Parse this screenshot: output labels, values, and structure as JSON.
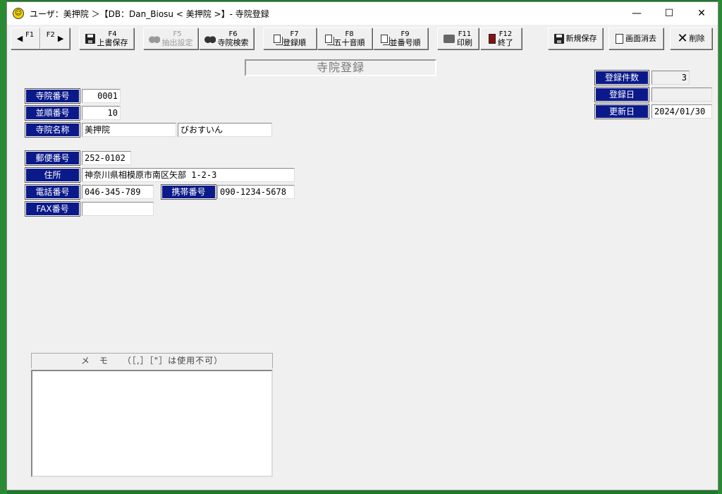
{
  "window": {
    "title": "ユーザ：美押院 ＞【DB：Dan_Biosu < 美押院 >】- 寺院登録"
  },
  "toolbar": {
    "prev_label": "F1",
    "next_label": "F2",
    "f4_key": "F4",
    "f4_label": "上書保存",
    "f5_key": "F5",
    "f5_label": "抽出設定",
    "f6_key": "F6",
    "f6_label": "寺院検索",
    "f7_key": "F7",
    "f7_label": "登録順",
    "f8_key": "F8",
    "f8_label": "五十音順",
    "f9_key": "F9",
    "f9_label": "並番号順",
    "f11_key": "F11",
    "f11_label": "印刷",
    "f12_key": "F12",
    "f12_label": "終了",
    "new_save_label": "新規保存",
    "clear_label": "画面消去",
    "delete_label": "削除"
  },
  "form": {
    "title": "寺院登録",
    "temple_number_label": "寺院番号",
    "temple_number": "0001",
    "order_number_label": "並順番号",
    "order_number": "10",
    "temple_name_label": "寺院名称",
    "temple_name": "美押院",
    "temple_name_kana": "びおすいん",
    "postal_label": "郵便番号",
    "postal": "252-0102",
    "address_label": "住所",
    "address": "神奈川県相模原市南区矢部 1-2-3",
    "phone_label": "電話番号",
    "phone": "046-345-789",
    "mobile_label": "携帯番号",
    "mobile": "090-1234-5678",
    "fax_label": "FAX番号",
    "fax": ""
  },
  "stats": {
    "count_label": "登録件数",
    "count": "3",
    "registered_label": "登録日",
    "registered": "",
    "updated_label": "更新日",
    "updated": "2024/01/30"
  },
  "memo": {
    "header": "メ　モ　　（［,］［\"］は使用不可）",
    "value": ""
  }
}
